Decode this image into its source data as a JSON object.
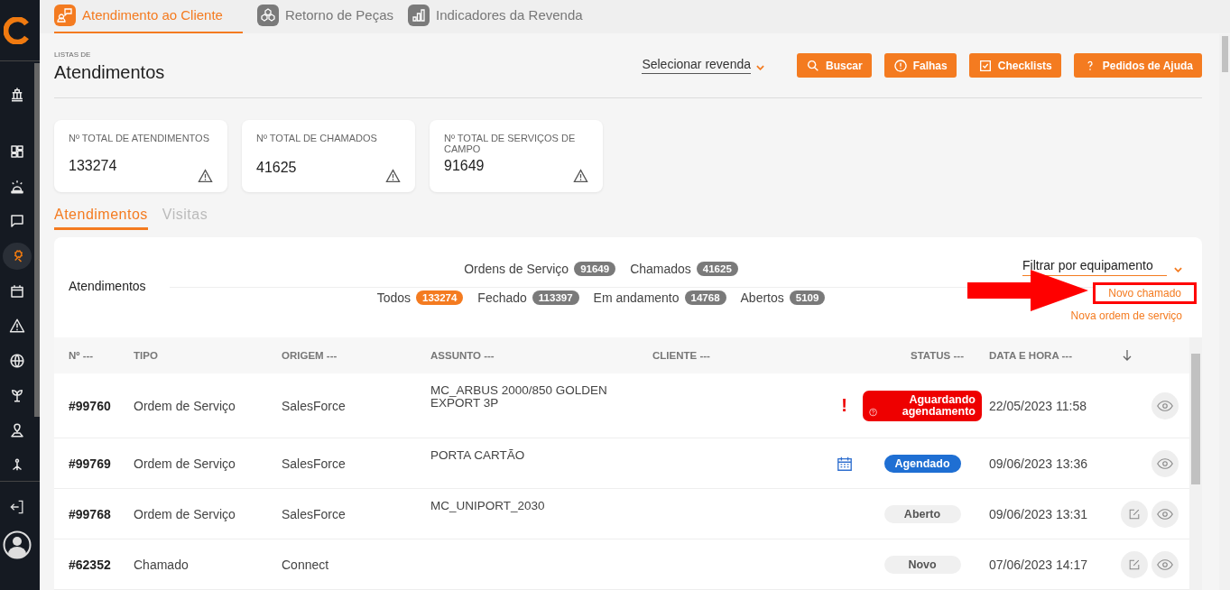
{
  "sidebar": {
    "items": [
      {
        "selected": false
      },
      {
        "selected": false
      },
      {
        "selected": false
      },
      {
        "selected": false
      },
      {
        "selected": true
      },
      {
        "selected": false
      },
      {
        "selected": false
      },
      {
        "selected": false
      },
      {
        "selected": false
      },
      {
        "selected": false
      },
      {
        "selected": false
      }
    ]
  },
  "nav_tabs": [
    {
      "label": "Atendimento ao Cliente",
      "selected": true
    },
    {
      "label": "Retorno de Peças",
      "selected": false
    },
    {
      "label": "Indicadores da Revenda",
      "selected": false
    }
  ],
  "header": {
    "eyebrow": "LISTAS DE",
    "title": "Atendimentos",
    "select_placeholder": "Selecionar revenda",
    "buttons": [
      "Buscar",
      "Falhas",
      "Checklists",
      "Pedidos de Ajuda"
    ]
  },
  "stats": [
    {
      "label": "Nº TOTAL DE ATENDIMENTOS",
      "value": "133274"
    },
    {
      "label": "Nº TOTAL DE CHAMADOS",
      "value": "41625"
    },
    {
      "label": "Nº TOTAL DE SERVIÇOS DE CAMPO",
      "value": "91649"
    }
  ],
  "sub_tabs": [
    {
      "label": "Atendimentos",
      "selected": true
    },
    {
      "label": "Visitas",
      "selected": false
    }
  ],
  "panel": {
    "title": "Atendimentos",
    "counter_rows": [
      [
        {
          "label": "Ordens de Serviço",
          "count": "91649",
          "selected": false
        },
        {
          "label": "Chamados",
          "count": "41625",
          "selected": false
        }
      ],
      [
        {
          "label": "Todos",
          "count": "133274",
          "selected": true
        },
        {
          "label": "Fechado",
          "count": "113397",
          "selected": false
        },
        {
          "label": "Em andamento",
          "count": "14768",
          "selected": false
        },
        {
          "label": "Abertos",
          "count": "5109",
          "selected": false
        }
      ]
    ],
    "filter_placeholder": "Filtrar por equipamento",
    "links": [
      {
        "label": "Novo chamado",
        "highlighted": true
      },
      {
        "label": "Nova ordem de serviço",
        "highlighted": false
      }
    ]
  },
  "table": {
    "columns": [
      "Nº ---",
      "TIPO",
      "ORIGEM ---",
      "ASSUNTO ---",
      "CLIENTE ---",
      "STATUS ---",
      "DATA E HORA ---"
    ],
    "rows": [
      {
        "number": "#99760",
        "type": "Ordem de Serviço",
        "origin": "SalesForce",
        "subject": "MC_ARBUS 2000/850 GOLDEN EXPORT 3P",
        "indicator": {
          "kind": "text",
          "text": "!"
        },
        "status": {
          "label": "Aguardando agendamento",
          "kind": "waiting"
        },
        "datetime": "22/05/2023 11:58",
        "editable": false
      },
      {
        "number": "#99769",
        "type": "Ordem de Serviço",
        "origin": "SalesForce",
        "subject": "PORTA CARTÃO",
        "indicator": {
          "kind": "calendar"
        },
        "status": {
          "label": "Agendado",
          "kind": "scheduled"
        },
        "datetime": "09/06/2023 13:36",
        "editable": false
      },
      {
        "number": "#99768",
        "type": "Ordem de Serviço",
        "origin": "SalesForce",
        "subject": "MC_UNIPORT_2030",
        "status": {
          "label": "Aberto",
          "kind": "open"
        },
        "datetime": "09/06/2023 13:31",
        "editable": true
      },
      {
        "number": "#62352",
        "type": "Chamado",
        "origin": "Connect",
        "subject": "",
        "status": {
          "label": "Novo",
          "kind": "new"
        },
        "datetime": "07/06/2023 14:17",
        "editable": true
      }
    ]
  }
}
